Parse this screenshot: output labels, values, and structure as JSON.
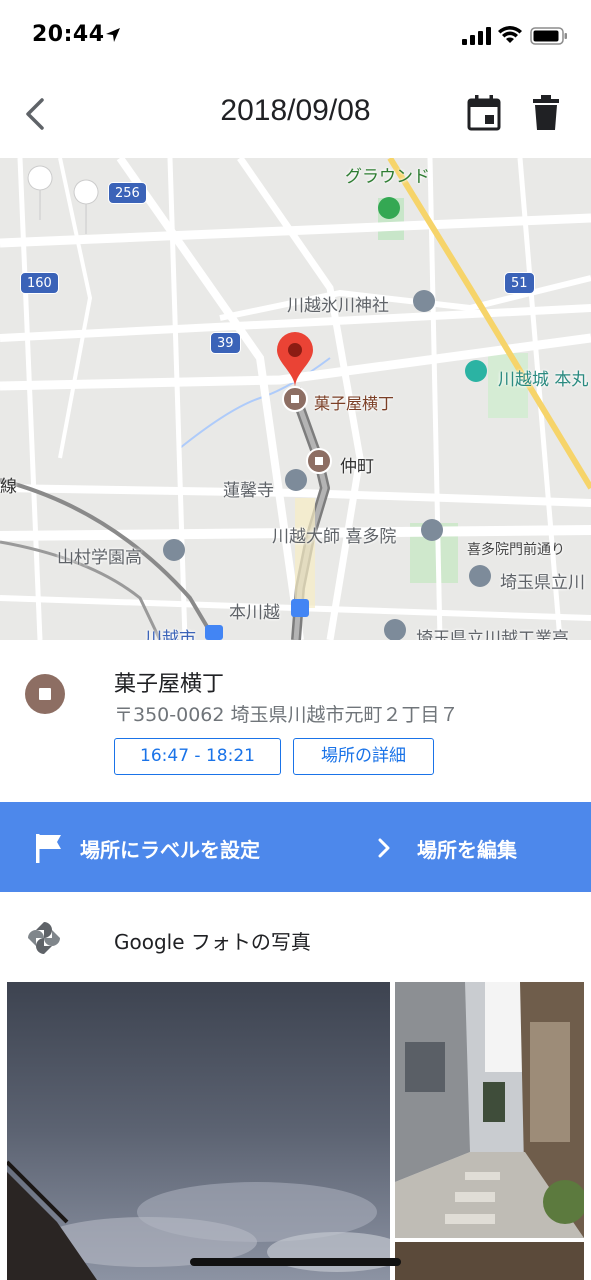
{
  "status_bar": {
    "time": "20:44",
    "icons": [
      "location-arrow-icon",
      "cellular-signal-icon",
      "wifi-icon",
      "battery-icon"
    ]
  },
  "header": {
    "title": "2018/09/08",
    "back_icon": "chevron-left-icon",
    "calendar_icon": "calendar-icon",
    "delete_icon": "trash-icon"
  },
  "map": {
    "labels": {
      "ground": "グラウンド",
      "shrine": "川越氷川神社",
      "castle": "川越城 本丸",
      "kashiya": "菓子屋横丁",
      "nakacho": "仲町",
      "renkeiji": "蓮馨寺",
      "kitain": "川越大師 喜多院",
      "kitain_gate": "喜多院門前通り",
      "yamamura": "山村学園高",
      "saitama_kenritsu": "埼玉県立川",
      "saitama_kenritsu2": "埼玉県立川越工業高",
      "honkawagoe": "本川越",
      "kawagoeshi": "川越市",
      "sen": "線"
    },
    "route_shields": [
      "256",
      "160",
      "39",
      "51"
    ]
  },
  "place": {
    "name": "菓子屋横丁",
    "address": "〒350-0062 埼玉県川越市元町２丁目７",
    "time_chip": "16:47 - 18:21",
    "detail_chip": "場所の詳細"
  },
  "actions": {
    "label_button": "場所にラベルを設定",
    "edit_button": "場所を編集"
  },
  "photos": {
    "title": "Google フォトの写真"
  },
  "colors": {
    "accent_blue": "#4d88eb",
    "link_blue": "#1a73e8",
    "place_brown": "#8d6e63",
    "pin_red": "#ea4335"
  }
}
